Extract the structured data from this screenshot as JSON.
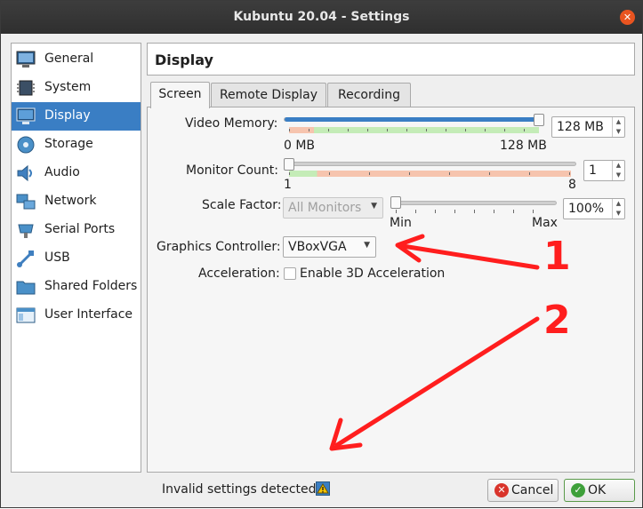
{
  "window": {
    "title": "Kubuntu 20.04 - Settings"
  },
  "sidebar": {
    "items": [
      {
        "label": "General",
        "icon": "monitor-general-icon"
      },
      {
        "label": "System",
        "icon": "chip-icon"
      },
      {
        "label": "Display",
        "icon": "display-icon",
        "selected": true
      },
      {
        "label": "Storage",
        "icon": "storage-icon"
      },
      {
        "label": "Audio",
        "icon": "speaker-icon"
      },
      {
        "label": "Network",
        "icon": "network-icon"
      },
      {
        "label": "Serial Ports",
        "icon": "serial-port-icon"
      },
      {
        "label": "USB",
        "icon": "usb-icon"
      },
      {
        "label": "Shared Folders",
        "icon": "folder-icon"
      },
      {
        "label": "User Interface",
        "icon": "window-icon"
      }
    ]
  },
  "header": {
    "title": "Display"
  },
  "tabs": [
    {
      "label": "Screen",
      "active": true
    },
    {
      "label": "Remote Display",
      "active": false
    },
    {
      "label": "Recording",
      "active": false
    }
  ],
  "screen": {
    "video_memory": {
      "label": "Video Memory:",
      "value": "128 MB",
      "min_label": "0 MB",
      "max_label": "128 MB",
      "level": 1.0
    },
    "monitor_count": {
      "label": "Monitor Count:",
      "value": "1",
      "min_label": "1",
      "max_label": "8",
      "level": 0.0
    },
    "scale_factor": {
      "label": "Scale Factor:",
      "monitor_select": "All Monitors",
      "value": "100%",
      "min_label": "Min",
      "max_label": "Max",
      "level": 0.0
    },
    "graphics_controller": {
      "label": "Graphics Controller:",
      "value": "VBoxVGA"
    },
    "acceleration": {
      "label": "Acceleration:",
      "checkbox_label": "Enable 3D Acceleration",
      "checked": false
    }
  },
  "footer": {
    "status": "Invalid settings detected",
    "cancel_label": "Cancel",
    "ok_label": "OK"
  },
  "annotations": {
    "first": "1",
    "second": "2"
  },
  "colors": {
    "accent": "#3a7ec4",
    "annotation": "#ff1e1e",
    "close": "#e95420"
  }
}
